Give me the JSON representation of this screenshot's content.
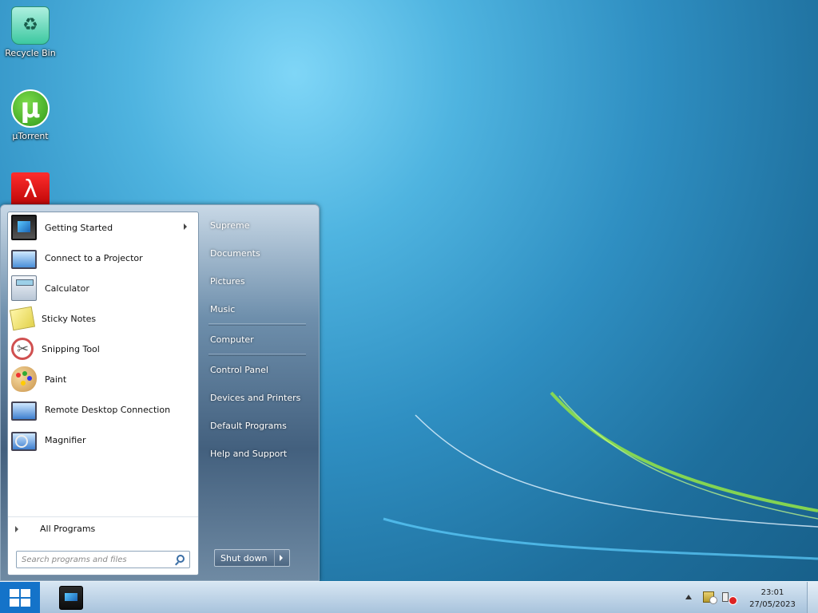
{
  "desktop": {
    "icons": [
      {
        "label": "Recycle Bin",
        "icon": "recycle-bin-icon"
      },
      {
        "label": "µTorrent",
        "icon": "utorrent-icon"
      },
      {
        "label": "",
        "icon": "adobe-acrobat-icon"
      }
    ]
  },
  "start_menu": {
    "programs": [
      {
        "label": "Getting Started",
        "icon": "getting-started-icon",
        "has_submenu": true
      },
      {
        "label": "Connect to a Projector",
        "icon": "projector-icon"
      },
      {
        "label": "Calculator",
        "icon": "calculator-icon"
      },
      {
        "label": "Sticky Notes",
        "icon": "sticky-notes-icon"
      },
      {
        "label": "Snipping Tool",
        "icon": "snipping-tool-icon"
      },
      {
        "label": "Paint",
        "icon": "paint-icon"
      },
      {
        "label": "Remote Desktop Connection",
        "icon": "remote-desktop-icon"
      },
      {
        "label": "Magnifier",
        "icon": "magnifier-icon"
      }
    ],
    "all_programs_label": "All Programs",
    "search_placeholder": "Search programs and files",
    "places": [
      "Supreme",
      "Documents",
      "Pictures",
      "Music",
      "Computer",
      "Control Panel",
      "Devices and Printers",
      "Default Programs",
      "Help and Support"
    ],
    "shutdown_label": "Shut down"
  },
  "taskbar": {
    "pinned": [
      {
        "icon": "media-center-icon"
      }
    ],
    "tray_icons": [
      "show-hidden-icons-icon",
      "action-center-flag-icon",
      "volume-muted-icon"
    ],
    "time": "23:01",
    "date": "27/05/2023"
  }
}
